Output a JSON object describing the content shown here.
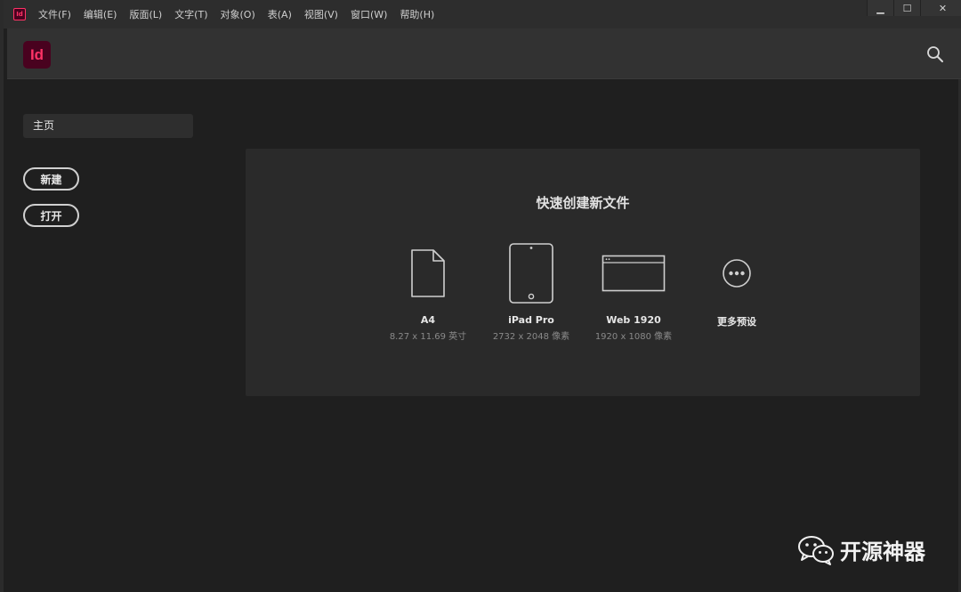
{
  "menubar": {
    "app_icon_text": "Id",
    "items": [
      "文件(F)",
      "编辑(E)",
      "版面(L)",
      "文字(T)",
      "对象(O)",
      "表(A)",
      "视图(V)",
      "窗口(W)",
      "帮助(H)"
    ],
    "window_controls": {
      "minimize": "▁",
      "maximize": "☐",
      "close": "✕"
    }
  },
  "header": {
    "logo_text": "Id",
    "search_icon": "search-icon"
  },
  "sidebar": {
    "home_label": "主页",
    "new_label": "新建",
    "open_label": "打开"
  },
  "quick_create": {
    "title": "快速创建新文件",
    "presets": [
      {
        "name": "A4",
        "size": "8.27 x 11.69 英寸",
        "icon": "document-icon"
      },
      {
        "name": "iPad Pro",
        "size": "2732 x 2048 像素",
        "icon": "tablet-icon"
      },
      {
        "name": "Web 1920",
        "size": "1920 x 1080 像素",
        "icon": "browser-window-icon"
      },
      {
        "name": "更多预设",
        "size": "",
        "icon": "more-icon"
      }
    ]
  },
  "watermark": {
    "text": "开源神器",
    "icon": "wechat-icon"
  },
  "colors": {
    "accent": "#ff3366",
    "logo_bg": "#49021f",
    "background": "#1f1f1f",
    "panel": "#2a2a2a",
    "header": "#323232"
  }
}
